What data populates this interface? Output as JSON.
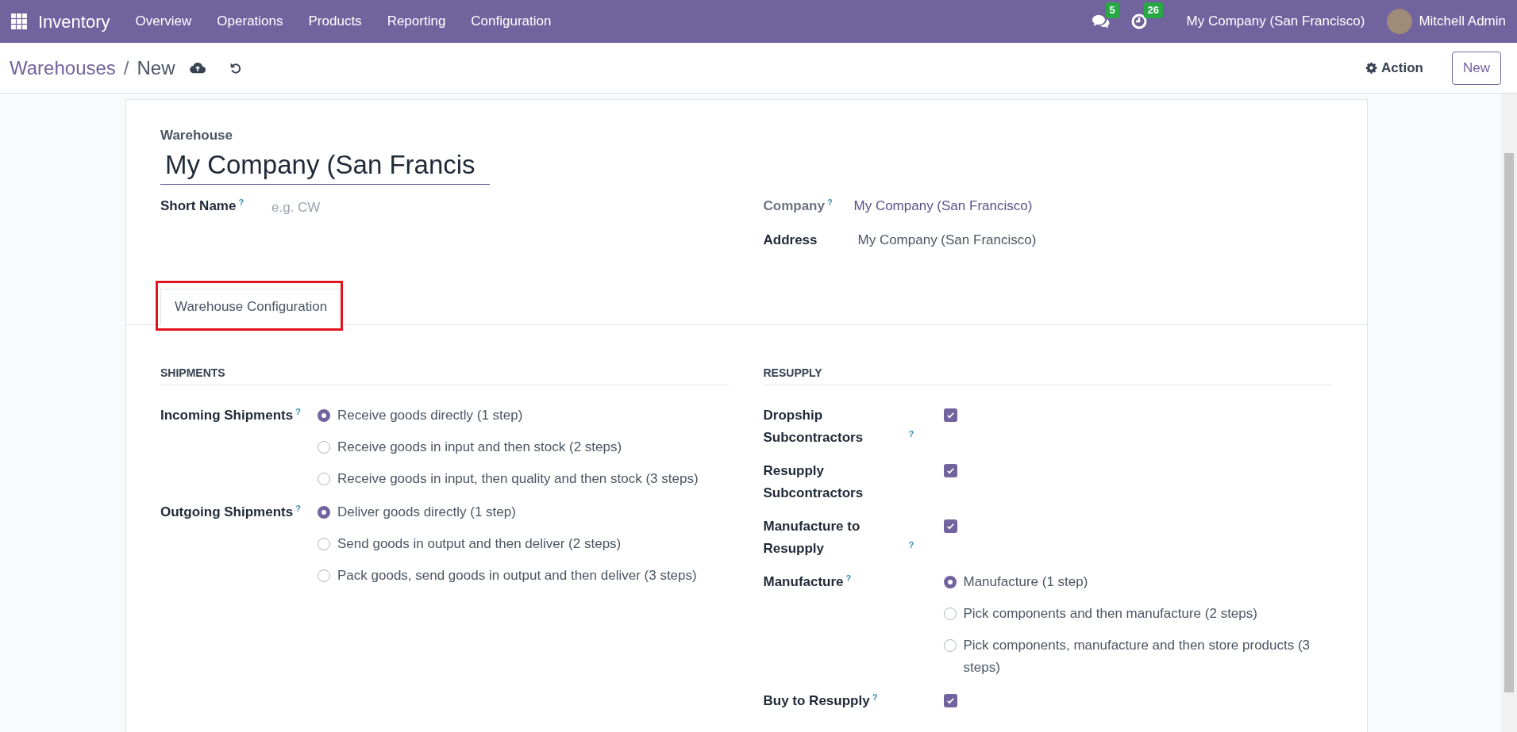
{
  "navbar": {
    "app_name": "Inventory",
    "menu": [
      "Overview",
      "Operations",
      "Products",
      "Reporting",
      "Configuration"
    ],
    "messages_count": "5",
    "activities_count": "26",
    "company": "My Company (San Francisco)",
    "user": "Mitchell Admin"
  },
  "breadcrumb": {
    "parent": "Warehouses",
    "separator": "/",
    "current": "New"
  },
  "control_panel": {
    "action": "Action",
    "new_button": "New"
  },
  "form": {
    "name_label": "Warehouse",
    "name_value": "My Company (San Francis",
    "short_name": {
      "label": "Short Name",
      "help": "?",
      "placeholder": "e.g. CW"
    },
    "company": {
      "label": "Company",
      "help": "?",
      "value": "My Company (San Francisco)"
    },
    "address": {
      "label": "Address",
      "value": "My Company (San Francisco)"
    },
    "tabs": [
      {
        "label": "Warehouse Configuration",
        "selected": true,
        "highlighted": true
      }
    ],
    "sections": [
      {
        "title": "SHIPMENTS",
        "rows": [
          {
            "kind": "radio",
            "label": "Incoming Shipments",
            "help": "?",
            "options": [
              {
                "label": "Receive goods directly (1 step)",
                "selected": true
              },
              {
                "label": "Receive goods in input and then stock (2 steps)",
                "selected": false
              },
              {
                "label": "Receive goods in input, then quality and then stock (3 steps)",
                "selected": false
              }
            ]
          },
          {
            "kind": "radio",
            "label": "Outgoing Shipments",
            "help": "?",
            "options": [
              {
                "label": "Deliver goods directly (1 step)",
                "selected": true
              },
              {
                "label": "Send goods in output and then deliver (2 steps)",
                "selected": false
              },
              {
                "label": "Pack goods, send goods in output and then deliver (3 steps)",
                "selected": false
              }
            ]
          }
        ]
      },
      {
        "title": "RESUPPLY",
        "rows": [
          {
            "kind": "checkbox",
            "label": "Dropship Subcontractors",
            "help": "?",
            "checked": true
          },
          {
            "kind": "checkbox",
            "label": "Resupply Subcontractors",
            "checked": true
          },
          {
            "kind": "checkbox",
            "label": "Manufacture to Resupply",
            "help": "?",
            "checked": true
          },
          {
            "kind": "radio",
            "label": "Manufacture",
            "help": "?",
            "options": [
              {
                "label": "Manufacture (1 step)",
                "selected": true
              },
              {
                "label": "Pick components and then manufacture (2 steps)",
                "selected": false
              },
              {
                "label": "Pick components, manufacture and then store products (3 steps)",
                "selected": false
              }
            ]
          },
          {
            "kind": "checkbox",
            "label": "Buy to Resupply",
            "help": "?",
            "checked": true
          }
        ]
      }
    ]
  }
}
